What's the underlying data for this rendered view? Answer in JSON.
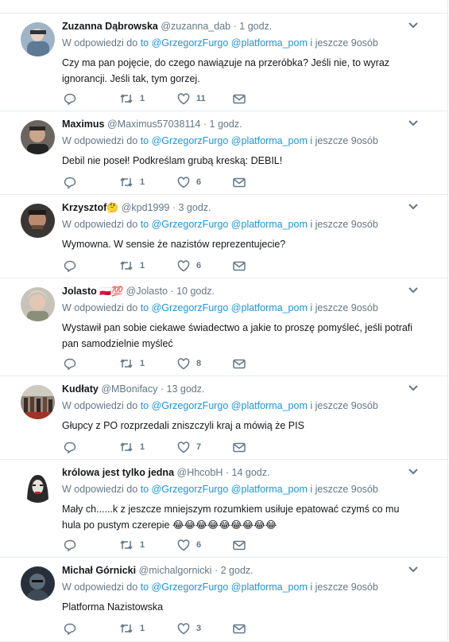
{
  "reply_prefix": "W odpowiedzi do",
  "reply_to": "to @GrzegorzFurgo @platforma_pom",
  "reply_suffix": "i jeszcze 9osób",
  "tweets": [
    {
      "name": "Zuzanna Dąbrowska",
      "handle": "@zuzanna_dab",
      "time": "1 godz.",
      "emoji": "",
      "text": "Czy ma pan pojęcie, do czego nawiązuje na przeróbka? Jeśli nie, to wyraz ignorancji. Jeśli tak, tym gorzej.",
      "retweets": "1",
      "likes": "11"
    },
    {
      "name": "Maximus",
      "handle": "@Maximus57038114",
      "time": "1 godz.",
      "emoji": "",
      "text": "Debil nie poseł! Podkreślam grubą kreską: DEBIL!",
      "retweets": "1",
      "likes": "6"
    },
    {
      "name": "Krzysztof",
      "handle": "@kpd1999",
      "time": "3 godz.",
      "emoji": "🤔",
      "text": "Wymowna. W sensie że nazistów reprezentujecie?",
      "retweets": "1",
      "likes": "6"
    },
    {
      "name": "Jolasto",
      "handle": "@Jolasto",
      "time": "10 godz.",
      "emoji": "🇵🇱💯",
      "text": "Wystawił pan sobie ciekawe świadectwo a jakie to proszę pomyśleć, jeśli potrafi pan samodzielnie myśleć",
      "retweets": "1",
      "likes": "8"
    },
    {
      "name": "Kudłaty",
      "handle": "@MBonifacy",
      "time": "13 godz.",
      "emoji": "",
      "text": "Głupcy z PO rozprzedali zniszczyli kraj a mówią że PIS",
      "retweets": "1",
      "likes": "7"
    },
    {
      "name": "królowa jest tylko jedna",
      "handle": "@HhcobH",
      "time": "14 godz.",
      "emoji": "",
      "text": "Mały ch......k z jeszcze mniejszym rozumkiem usiłuje epatować czymś co mu hula po pustym czerepie 😂😂😂😂😂😂😂😂😂",
      "retweets": "1",
      "likes": "6"
    },
    {
      "name": "Michał Górnicki",
      "handle": "@michalgornicki",
      "time": "2 godz.",
      "emoji": "",
      "text": "Platforma Nazistowska",
      "retweets": "1",
      "likes": "3"
    }
  ]
}
